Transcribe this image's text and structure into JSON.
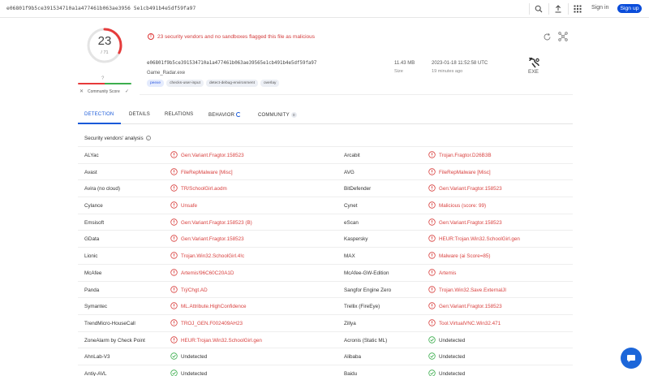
{
  "topbar": {
    "hash": "e06801f9b5ce391534710a1a477461b063ae3956 5e1cb491b4e5df59fa97",
    "sign_in": "Sign in",
    "sign_up": "Sign up",
    "icons": [
      "search-icon",
      "upload-icon",
      "apps-grid-icon"
    ]
  },
  "score": {
    "detections": "23",
    "total": "/ 71",
    "community_mark": "?",
    "community_label": "Community Score",
    "colors": {
      "malicious": "#e63b3b",
      "harmless": "#3cae4e",
      "ring_track": "#e4e4e4"
    }
  },
  "alert": {
    "text": "23 security vendors and no sandboxes flagged this file as malicious",
    "color": "#d33a3a"
  },
  "file": {
    "hash": "e06801f9b5ce391534710a1a477461b063ae39565e1cb491b4e5df59fa97",
    "name": "Game_Radar.exe",
    "tags": [
      "peexe",
      "checks-user-input",
      "detect-debug-environment",
      "overlay"
    ],
    "size_value": "11.43 MB",
    "size_label": "Size",
    "date_value": "2023-01-18 11:52:58 UTC",
    "date_relative": "19 minutes ago",
    "type_label": "EXE"
  },
  "tabs": [
    {
      "label": "DETECTION"
    },
    {
      "label": "DETAILS"
    },
    {
      "label": "RELATIONS"
    },
    {
      "label": "BEHAVIOR"
    },
    {
      "label": "COMMUNITY",
      "badge": "0"
    }
  ],
  "vendors": {
    "title": "Security vendors' analysis",
    "rows": [
      {
        "left": {
          "vendor": "ALYac",
          "result": "Gen:Variant.Fragtor.158523",
          "malicious": true
        },
        "right": {
          "vendor": "Arcabit",
          "result": "Trojan.Fragtor.D26B3B",
          "malicious": true
        }
      },
      {
        "left": {
          "vendor": "Avast",
          "result": "FileRepMalware [Misc]",
          "malicious": true
        },
        "right": {
          "vendor": "AVG",
          "result": "FileRepMalware [Misc]",
          "malicious": true
        }
      },
      {
        "left": {
          "vendor": "Avira (no cloud)",
          "result": "TR/SchoolGirl.aodm",
          "malicious": true
        },
        "right": {
          "vendor": "BitDefender",
          "result": "Gen:Variant.Fragtor.158523",
          "malicious": true
        }
      },
      {
        "left": {
          "vendor": "Cylance",
          "result": "Unsafe",
          "malicious": true
        },
        "right": {
          "vendor": "Cynet",
          "result": "Malicious (score: 99)",
          "malicious": true
        }
      },
      {
        "left": {
          "vendor": "Emsisoft",
          "result": "Gen:Variant.Fragtor.158523 (B)",
          "malicious": true
        },
        "right": {
          "vendor": "eScan",
          "result": "Gen:Variant.Fragtor.158523",
          "malicious": true
        }
      },
      {
        "left": {
          "vendor": "GData",
          "result": "Gen:Variant.Fragtor.158523",
          "malicious": true
        },
        "right": {
          "vendor": "Kaspersky",
          "result": "HEUR:Trojan.Win32.SchoolGirl.gen",
          "malicious": true
        }
      },
      {
        "left": {
          "vendor": "Lionic",
          "result": "Trojan.Win32.SchoolGirl.4!c",
          "malicious": true
        },
        "right": {
          "vendor": "MAX",
          "result": "Malware (ai Score=85)",
          "malicious": true
        }
      },
      {
        "left": {
          "vendor": "McAfee",
          "result": "Artemis!96C60C20A1D",
          "malicious": true
        },
        "right": {
          "vendor": "McAfee-GW-Edition",
          "result": "Artemis",
          "malicious": true
        }
      },
      {
        "left": {
          "vendor": "Panda",
          "result": "Trj/Chgt.AD",
          "malicious": true
        },
        "right": {
          "vendor": "Sangfor Engine Zero",
          "result": "Trojan.Win32.Save.ExternalJI",
          "malicious": true
        }
      },
      {
        "left": {
          "vendor": "Symantec",
          "result": "ML.Attribute.HighConfidence",
          "malicious": true
        },
        "right": {
          "vendor": "Trellix (FireEye)",
          "result": "Gen:Variant.Fragtor.158523",
          "malicious": true
        }
      },
      {
        "left": {
          "vendor": "TrendMicro-HouseCall",
          "result": "TROJ_GEN.F002409AH23",
          "malicious": true
        },
        "right": {
          "vendor": "Zillya",
          "result": "Tool.VirtualVNC.Win32.471",
          "malicious": true
        }
      },
      {
        "left": {
          "vendor": "ZoneAlarm by Check Point",
          "result": "HEUR:Trojan.Win32.SchoolGirl.gen",
          "malicious": true
        },
        "right": {
          "vendor": "Acronis (Static ML)",
          "result": "Undetected",
          "malicious": false
        }
      },
      {
        "left": {
          "vendor": "AhnLab-V3",
          "result": "Undetected",
          "malicious": false
        },
        "right": {
          "vendor": "Alibaba",
          "result": "Undetected",
          "malicious": false
        }
      },
      {
        "left": {
          "vendor": "Antiy-AVL",
          "result": "Undetected",
          "malicious": false
        },
        "right": {
          "vendor": "Baidu",
          "result": "Undetected",
          "malicious": false
        }
      }
    ]
  },
  "chat": {
    "icon": "chat-bubble-icon"
  }
}
